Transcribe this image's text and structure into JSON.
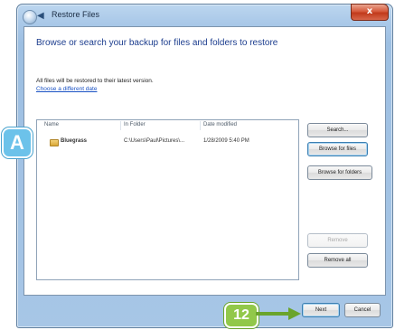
{
  "window": {
    "title": "Restore Files",
    "close_label": "x"
  },
  "content": {
    "heading": "Browse or search your backup for files and folders to restore",
    "description": "All files will be restored to their latest version.",
    "link": "Choose a different date"
  },
  "list": {
    "columns": [
      "Name",
      "In Folder",
      "Date modified"
    ],
    "rows": [
      {
        "name": "Bluegrass",
        "folder": "C:\\Users\\Paul\\Pictures\\...",
        "date": "1/28/2009 5:40 PM"
      }
    ]
  },
  "buttons": {
    "search": "Search...",
    "browse_files": "Browse for files",
    "browse_folders": "Browse for folders",
    "remove": "Remove",
    "remove_all": "Remove all",
    "next": "Next",
    "cancel": "Cancel"
  },
  "callouts": {
    "a": "A",
    "step": "12"
  },
  "colors": {
    "callout_blue": "#6cc2ea",
    "callout_green": "#92c84a",
    "heading_blue": "#1c3d8e"
  }
}
